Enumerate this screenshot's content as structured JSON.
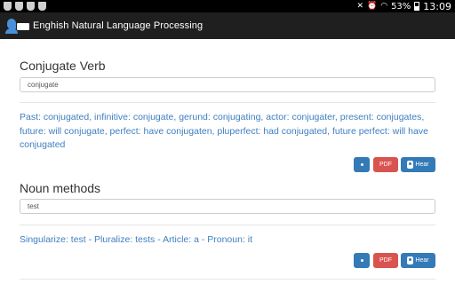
{
  "status_bar": {
    "battery": "53%",
    "time": "13:09"
  },
  "app": {
    "title": "Enghish Natural Language Processing"
  },
  "conjugate": {
    "title": "Conjugate Verb",
    "input_value": "conjugate",
    "result": "Past: conjugated, infinitive: conjugate, gerund: conjugating, actor: conjugater, present: conjugates, future: will conjugate, perfect: have conjugaten, pluperfect: had conjugated, future perfect: will have conjugated",
    "pdf_label": "PDF",
    "hear_label": "Hear"
  },
  "noun": {
    "title": "Noun methods",
    "input_value": "test",
    "result": "Singularize: test - Pluralize: tests - Article: a - Pronoun: it",
    "pdf_label": "PDF",
    "hear_label": "Hear"
  },
  "colors": {
    "primary": "#337ab7",
    "danger": "#d9534f",
    "link": "#3f7fbf",
    "appbar": "#1f1f1f"
  }
}
